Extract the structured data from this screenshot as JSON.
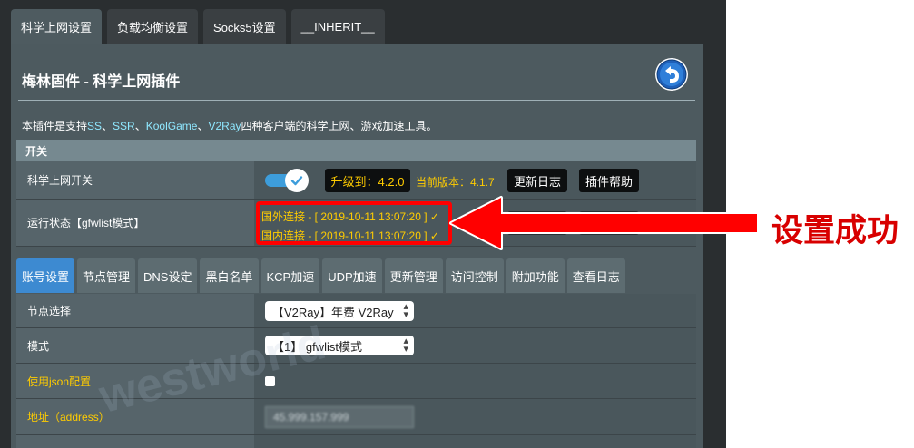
{
  "top_tabs": [
    "科学上网设置",
    "负载均衡设置",
    "Socks5设置",
    "__INHERIT__"
  ],
  "panel": {
    "title": "梅林固件 - 科学上网插件",
    "desc_prefix": "本插件是支持",
    "desc_links": [
      "SS",
      "SSR",
      "KoolGame",
      "V2Ray"
    ],
    "desc_sep": "、",
    "desc_suffix": "四种客户端的科学上网、游戏加速工具。"
  },
  "section": {
    "title": "开关"
  },
  "switch_row": {
    "label": "科学上网开关",
    "upgrade_label": "升级到：4.2.0",
    "current_version": "当前版本：4.1.7",
    "changelog_button": "更新日志",
    "help_button": "插件帮助"
  },
  "status_row": {
    "label": "运行状态【gfwlist模式】",
    "foreign": "国外连接 - [ 2019-10-11 13:07:20 ] ✓",
    "domestic": "国内连接 - [ 2019-10-11 13:07:20 ] ✓"
  },
  "sub_tabs": [
    "账号设置",
    "节点管理",
    "DNS设定",
    "黑白名单",
    "KCP加速",
    "UDP加速",
    "更新管理",
    "访问控制",
    "附加功能",
    "查看日志"
  ],
  "form": {
    "node_label": "节点选择",
    "node_value": "【V2Ray】年费 V2Ray",
    "mode_label": "模式",
    "mode_value": "【1】 gfwlist模式",
    "json_label": "使用json配置",
    "address_label": "地址（address）",
    "address_value": "45.999.157.999"
  },
  "annotation": {
    "text": "设置成功"
  },
  "watermark": "westworld",
  "colors": {
    "active_tab": "#3d8ad1",
    "status_text": "#ffcc00",
    "annotation_red": "#ff0000",
    "link": "#8fe8ff"
  }
}
